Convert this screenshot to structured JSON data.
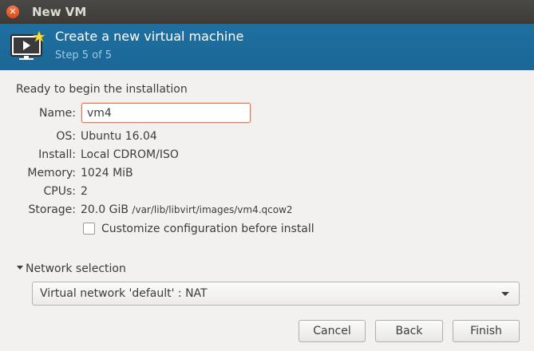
{
  "window": {
    "title": "New VM",
    "close_icon": "close-icon"
  },
  "banner": {
    "title": "Create a new virtual machine",
    "step": "Step 5 of 5",
    "icon": "vm-monitor-icon"
  },
  "summary": {
    "heading": "Ready to begin the installation",
    "name_label": "Name:",
    "name_value": "vm4",
    "os_label": "OS:",
    "os_value": "Ubuntu 16.04",
    "install_label": "Install:",
    "install_value": "Local CDROM/ISO",
    "memory_label": "Memory:",
    "memory_value": "1024 MiB",
    "cpus_label": "CPUs:",
    "cpus_value": "2",
    "storage_label": "Storage:",
    "storage_size": "20.0 GiB",
    "storage_path": "/var/lib/libvirt/images/vm4.qcow2",
    "customize_label": "Customize configuration before install",
    "customize_checked": false
  },
  "network": {
    "label": "Network selection",
    "selected": "Virtual network 'default' : NAT"
  },
  "buttons": {
    "cancel": "Cancel",
    "back": "Back",
    "finish": "Finish"
  }
}
